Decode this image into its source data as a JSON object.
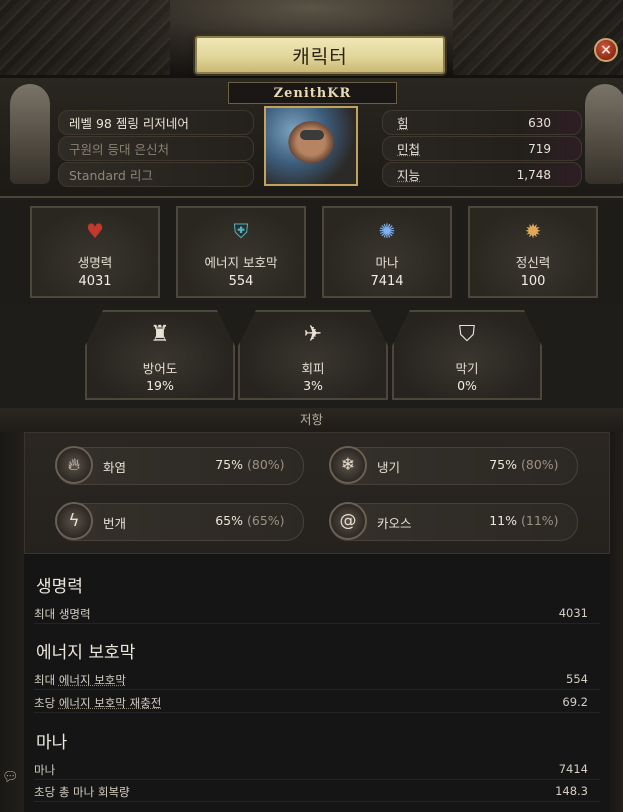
{
  "window": {
    "title": "캐릭터",
    "close_icon": "×"
  },
  "character": {
    "name": "ZenithKR",
    "info": [
      "레벨 98 젬링 리저네어",
      "구원의 등대 은신처",
      "Standard 리그"
    ],
    "attributes": [
      {
        "label": "힘",
        "value": "630"
      },
      {
        "label": "민첩",
        "value": "719"
      },
      {
        "label": "지능",
        "value": "1,748"
      }
    ]
  },
  "resources": [
    {
      "label": "생명력",
      "value": "4031",
      "icon": "heart-icon",
      "color": "#c0392b"
    },
    {
      "label": "에너지 보호막",
      "value": "554",
      "icon": "energy-shield-icon",
      "color": "#4fb3c6"
    },
    {
      "label": "마나",
      "value": "7414",
      "icon": "mana-icon",
      "color": "#5a8fd6"
    },
    {
      "label": "정신력",
      "value": "100",
      "icon": "spirit-icon",
      "color": "#d89b4f"
    }
  ],
  "defenses": [
    {
      "label": "방어도",
      "value": "19%",
      "icon": "armour-icon"
    },
    {
      "label": "회피",
      "value": "3%",
      "icon": "evasion-icon"
    },
    {
      "label": "막기",
      "value": "0%",
      "icon": "block-icon"
    }
  ],
  "resistances_header": "저항",
  "resistances": [
    {
      "label": "화염",
      "value": "75%",
      "max": "(80%)",
      "icon": "fire-icon"
    },
    {
      "label": "냉기",
      "value": "75%",
      "max": "(80%)",
      "icon": "cold-icon"
    },
    {
      "label": "번개",
      "value": "65%",
      "max": "(65%)",
      "icon": "lightning-icon"
    },
    {
      "label": "카오스",
      "value": "11%",
      "max": "(11%)",
      "icon": "chaos-icon"
    }
  ],
  "details": {
    "life": {
      "title": "생명력",
      "rows": [
        {
          "label": "최대 생명력",
          "value": "4031"
        }
      ]
    },
    "es": {
      "title": "에너지 보호막",
      "rows": [
        {
          "prefix": "최대 ",
          "label": "에너지 보호막",
          "value": "554"
        },
        {
          "prefix": "초당 ",
          "label": "에너지 보호막 재충전",
          "value": "69.2"
        }
      ]
    },
    "mana": {
      "title": "마나",
      "rows": [
        {
          "label": "마나",
          "value": "7414"
        },
        {
          "label": "초당 총 마나 회복량",
          "value": "148.3"
        }
      ]
    }
  }
}
